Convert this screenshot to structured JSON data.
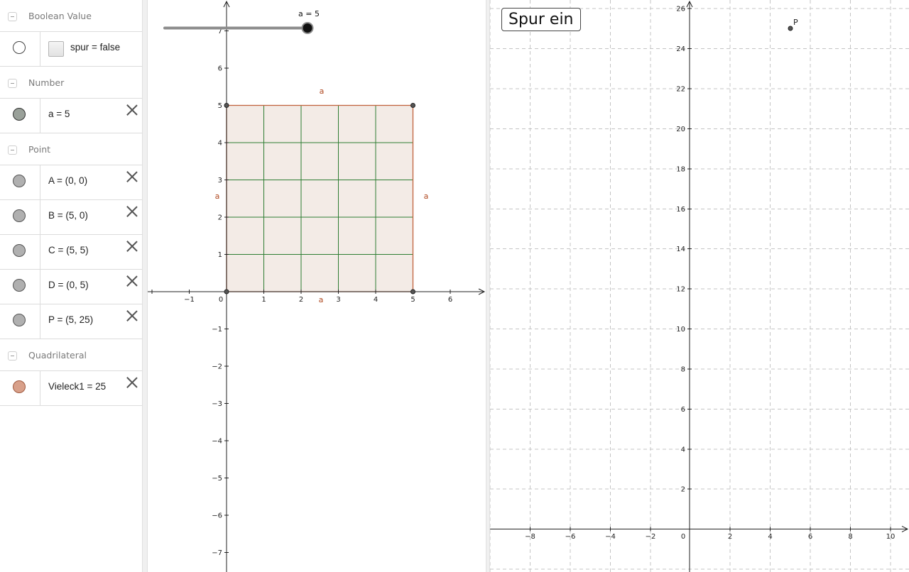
{
  "algebra": {
    "groups": {
      "boolean": {
        "label": "Boolean Value"
      },
      "number": {
        "label": "Number"
      },
      "point": {
        "label": "Point"
      },
      "quadrilateral": {
        "label": "Quadrilateral"
      }
    },
    "items": {
      "spur": {
        "text": "spur = false",
        "marker_color": "#ffffff"
      },
      "a": {
        "text": "a = 5",
        "marker_color": "#9aa19a"
      },
      "A": {
        "text": "A = (0, 0)",
        "marker_color": "#b0b0b0"
      },
      "B": {
        "text": "B = (5, 0)",
        "marker_color": "#b0b0b0"
      },
      "C": {
        "text": "C = (5, 5)",
        "marker_color": "#b0b0b0"
      },
      "D": {
        "text": "D = (0, 5)",
        "marker_color": "#b0b0b0"
      },
      "P": {
        "text": "P = (5, 25)",
        "marker_color": "#b0b0b0"
      },
      "vieleck": {
        "text": "Vieleck1 = 25",
        "marker_color": "#d8a08a"
      }
    }
  },
  "graphics1": {
    "slider": {
      "label": "a = 5",
      "value": 5,
      "min": 0,
      "max": 5
    },
    "x_ticks": [
      "−1",
      "0",
      "1",
      "2",
      "3",
      "4",
      "5",
      "6"
    ],
    "y_ticks": [
      "7",
      "6",
      "5",
      "4",
      "3",
      "2",
      "1",
      "−1",
      "−2",
      "−3",
      "−4",
      "−5",
      "−6",
      "−7"
    ],
    "square": {
      "side": 5,
      "side_label": "a",
      "fill_color": "#f3ebe6",
      "edge_color": "#c0603a",
      "grid_color": "#2e7d32"
    }
  },
  "graphics2": {
    "button_label": "Spur ein",
    "x_ticks": [
      "−8",
      "−6",
      "−4",
      "−2",
      "0",
      "2",
      "4",
      "6",
      "8",
      "10"
    ],
    "y_ticks": [
      "26",
      "24",
      "22",
      "20",
      "18",
      "16",
      "14",
      "12",
      "10",
      "8",
      "6",
      "4",
      "2"
    ],
    "point_label": "P",
    "point_x": 5,
    "point_y": 25
  },
  "colors": {
    "axis": "#222222",
    "grid": "#c4c4c4",
    "slider_track": "#8c8c8c"
  }
}
